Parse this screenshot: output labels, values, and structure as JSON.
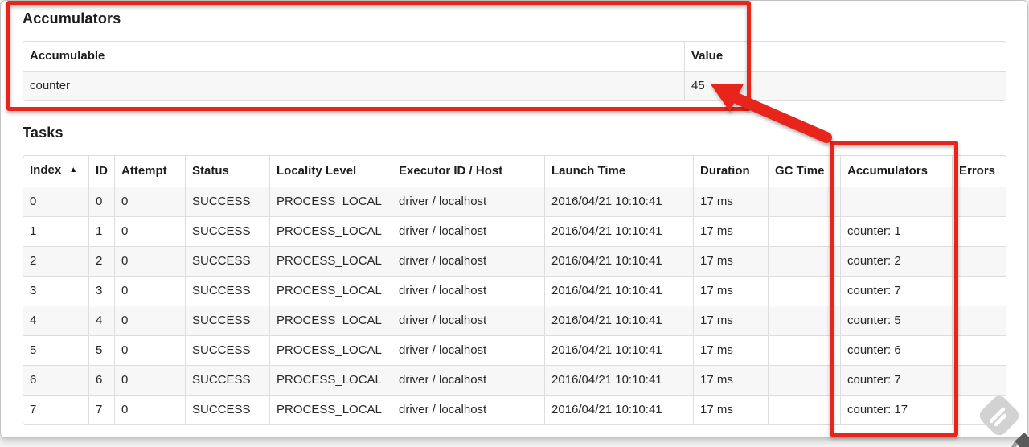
{
  "accumulators_section": {
    "title": "Accumulators",
    "table": {
      "headers": [
        "Accumulable",
        "Value"
      ],
      "rows": [
        {
          "accumulable": "counter",
          "value": "45"
        }
      ]
    }
  },
  "tasks_section": {
    "title": "Tasks",
    "table": {
      "headers": [
        "Index",
        "ID",
        "Attempt",
        "Status",
        "Locality Level",
        "Executor ID / Host",
        "Launch Time",
        "Duration",
        "GC Time",
        "Accumulators",
        "Errors"
      ],
      "sort_indicator": "▲",
      "sorted_column": "Index",
      "rows": [
        [
          "0",
          "0",
          "0",
          "SUCCESS",
          "PROCESS_LOCAL",
          "driver / localhost",
          "2016/04/21 10:10:41",
          "17 ms",
          "",
          "",
          ""
        ],
        [
          "1",
          "1",
          "0",
          "SUCCESS",
          "PROCESS_LOCAL",
          "driver / localhost",
          "2016/04/21 10:10:41",
          "17 ms",
          "",
          "counter: 1",
          ""
        ],
        [
          "2",
          "2",
          "0",
          "SUCCESS",
          "PROCESS_LOCAL",
          "driver / localhost",
          "2016/04/21 10:10:41",
          "17 ms",
          "",
          "counter: 2",
          ""
        ],
        [
          "3",
          "3",
          "0",
          "SUCCESS",
          "PROCESS_LOCAL",
          "driver / localhost",
          "2016/04/21 10:10:41",
          "17 ms",
          "",
          "counter: 7",
          ""
        ],
        [
          "4",
          "4",
          "0",
          "SUCCESS",
          "PROCESS_LOCAL",
          "driver / localhost",
          "2016/04/21 10:10:41",
          "17 ms",
          "",
          "counter: 5",
          ""
        ],
        [
          "5",
          "5",
          "0",
          "SUCCESS",
          "PROCESS_LOCAL",
          "driver / localhost",
          "2016/04/21 10:10:41",
          "17 ms",
          "",
          "counter: 6",
          ""
        ],
        [
          "6",
          "6",
          "0",
          "SUCCESS",
          "PROCESS_LOCAL",
          "driver / localhost",
          "2016/04/21 10:10:41",
          "17 ms",
          "",
          "counter: 7",
          ""
        ],
        [
          "7",
          "7",
          "0",
          "SUCCESS",
          "PROCESS_LOCAL",
          "driver / localhost",
          "2016/04/21 10:10:41",
          "17 ms",
          "",
          "counter: 17",
          ""
        ]
      ]
    }
  },
  "annotations": {
    "highlight_color": "#e8251a"
  }
}
